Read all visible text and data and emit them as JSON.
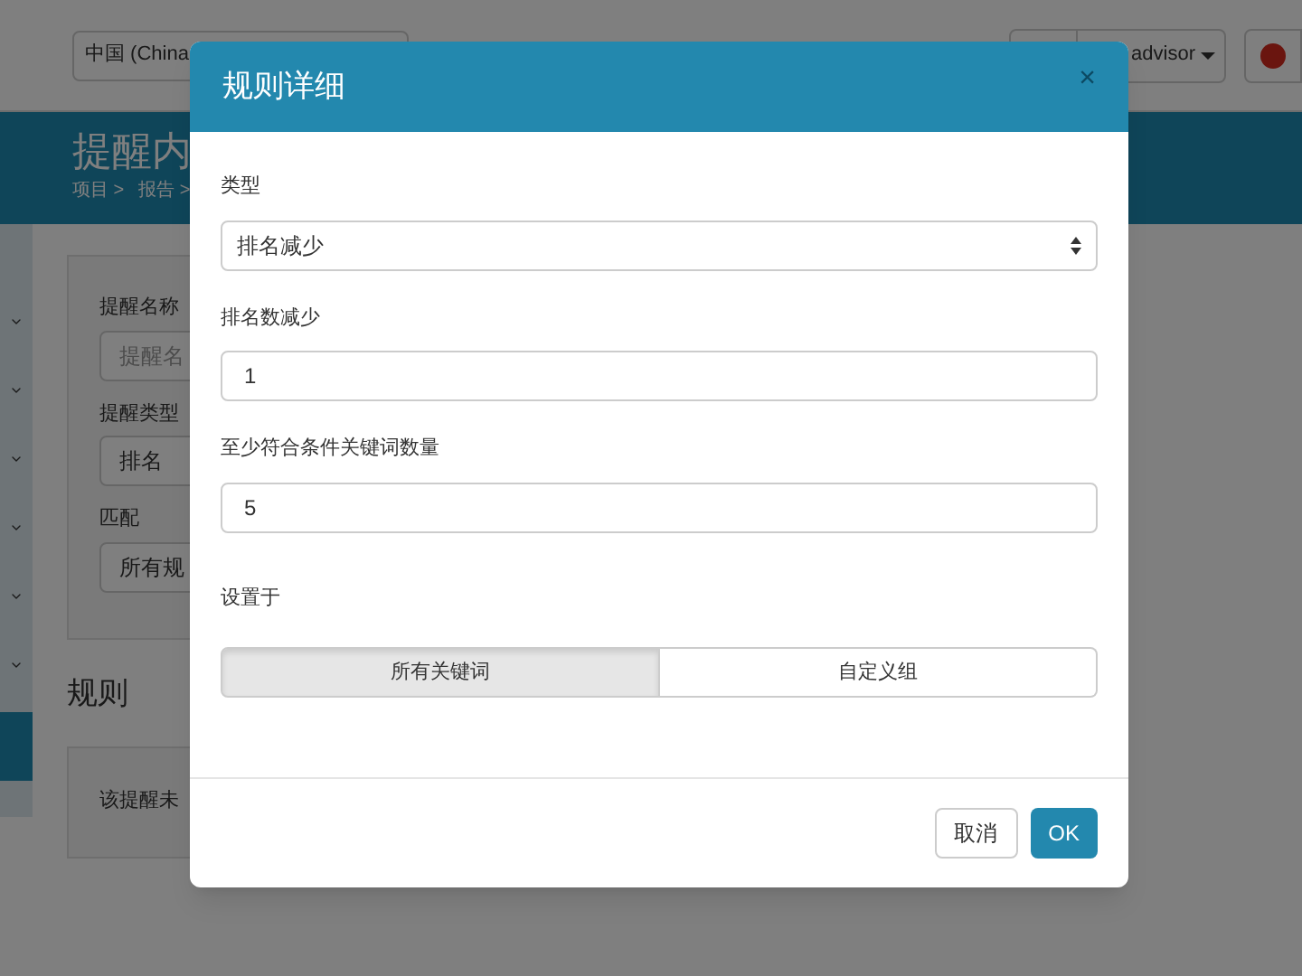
{
  "topbar": {
    "country_select": "中国 (China",
    "account_button": "advisor"
  },
  "header": {
    "title": "提醒内",
    "breadcrumb": [
      "项目 >",
      "报告 >"
    ]
  },
  "sidebar": {
    "items": [
      {
        "kind": "chevron"
      },
      {
        "kind": "chevron"
      },
      {
        "kind": "chevron"
      },
      {
        "kind": "chevron"
      },
      {
        "kind": "chevron"
      },
      {
        "kind": "chevron"
      },
      {
        "kind": "active"
      }
    ]
  },
  "alert_form": {
    "fields": [
      {
        "label": "提醒名称",
        "placeholder": "提醒名"
      },
      {
        "label": "提醒类型",
        "value": "排名"
      },
      {
        "label": "匹配",
        "value": "所有规"
      }
    ]
  },
  "rules": {
    "heading": "规则",
    "empty_text": "该提醒未"
  },
  "modal": {
    "title": "规则详细",
    "close": "×",
    "type_label": "类型",
    "type_value": "排名减少",
    "fields": [
      {
        "label": "排名数减少",
        "value": "1"
      },
      {
        "label": "至少符合条件关键词数量",
        "value": "5"
      }
    ],
    "scope_label": "设置于",
    "scope_options": [
      {
        "label": "所有关键词",
        "selected": true
      },
      {
        "label": "自定义组",
        "selected": false
      }
    ],
    "buttons": [
      {
        "label": "取消",
        "kind": "default"
      },
      {
        "label": "OK",
        "kind": "primary"
      }
    ]
  }
}
